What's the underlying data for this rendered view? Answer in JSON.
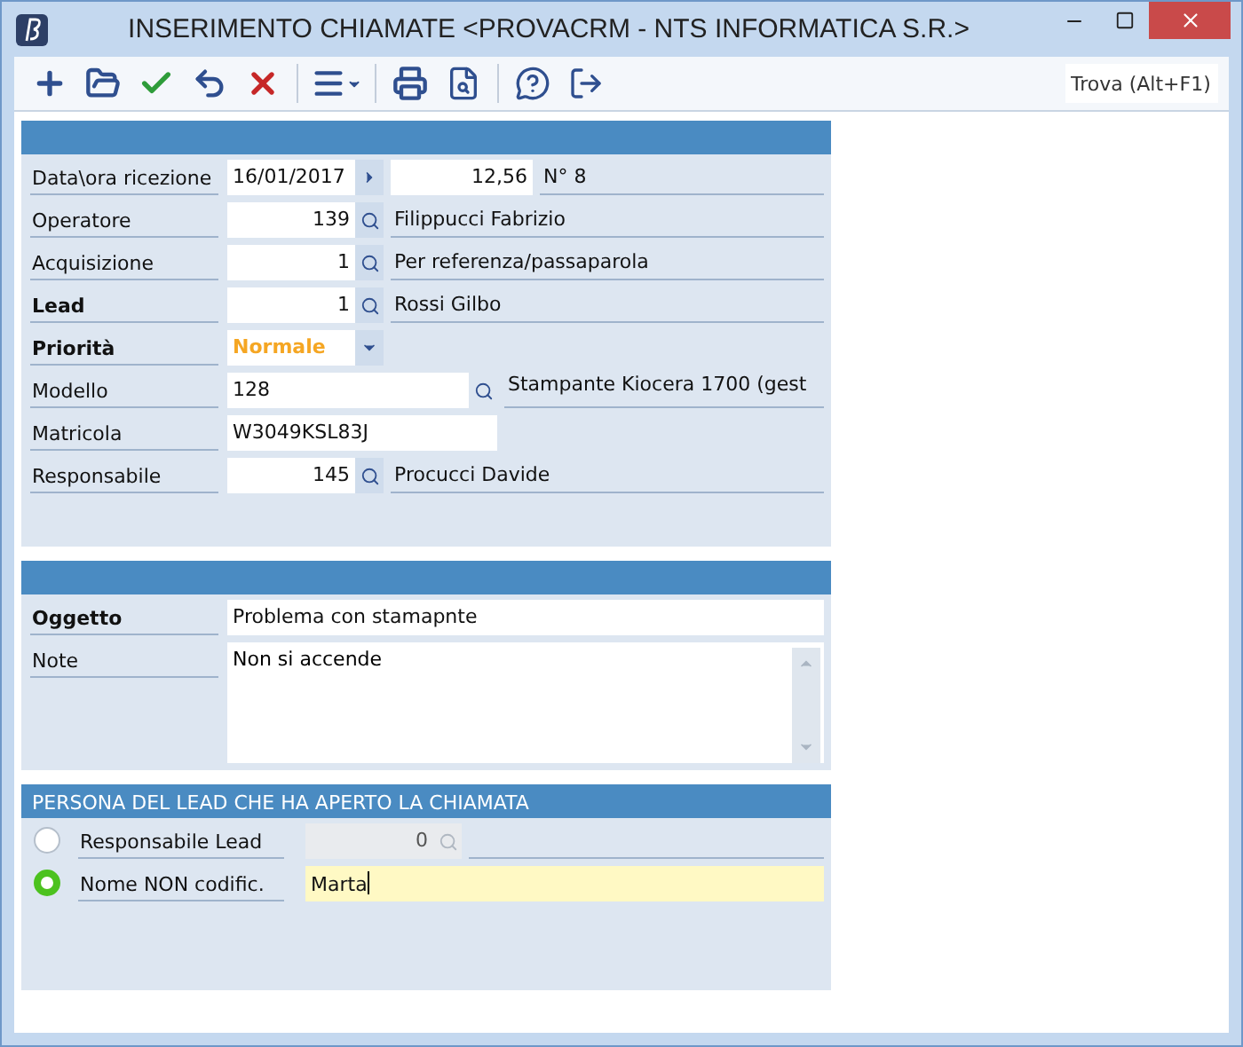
{
  "window": {
    "title": "INSERIMENTO CHIAMATE <PROVACRM - NTS INFORMATICA S.R.>"
  },
  "toolbar": {
    "search": {
      "placeholder": "Trova (Alt+F1)"
    }
  },
  "header_panel": {
    "rows": [
      {
        "kind": "date",
        "label": "Data\\ora ricezione",
        "bold": false,
        "value": "16/01/2017",
        "time": "12,56",
        "number": "N° 8"
      },
      {
        "kind": "lookup",
        "label": "Operatore",
        "bold": false,
        "value": "139",
        "description": "Filippucci Fabrizio"
      },
      {
        "kind": "lookup",
        "label": "Acquisizione",
        "bold": false,
        "value": "1",
        "description": "Per referenza/passaparola"
      },
      {
        "kind": "lookup",
        "label": "Lead",
        "bold": true,
        "value": "1",
        "description": "Rossi Gilbo"
      },
      {
        "kind": "dropdown",
        "label": "Priorità",
        "bold": true,
        "value": "Normale"
      },
      {
        "kind": "wide_lookup",
        "label": "Modello",
        "bold": false,
        "value": "128",
        "description": "Stampante Kiocera 1700  (gest"
      },
      {
        "kind": "text",
        "label": "Matricola",
        "bold": false,
        "value": "W3049KSL83J"
      },
      {
        "kind": "lookup",
        "label": "Responsabile",
        "bold": false,
        "value": "145",
        "description": "Procucci Davide"
      }
    ]
  },
  "subject_panel": {
    "subject": {
      "label": "Oggetto",
      "value": "Problema con stamapnte"
    },
    "notes": {
      "label": "Note",
      "value": "Non si accende"
    }
  },
  "contact_panel": {
    "title": "PERSONA DEL LEAD CHE HA APERTO LA CHIAMATA",
    "options": [
      {
        "kind": "lookup",
        "label": "Responsabile Lead",
        "selected": false,
        "value": "0",
        "disabled": true
      },
      {
        "kind": "text",
        "label": "Nome NON codific.",
        "selected": true,
        "value": "Marta",
        "focused": true
      }
    ]
  }
}
